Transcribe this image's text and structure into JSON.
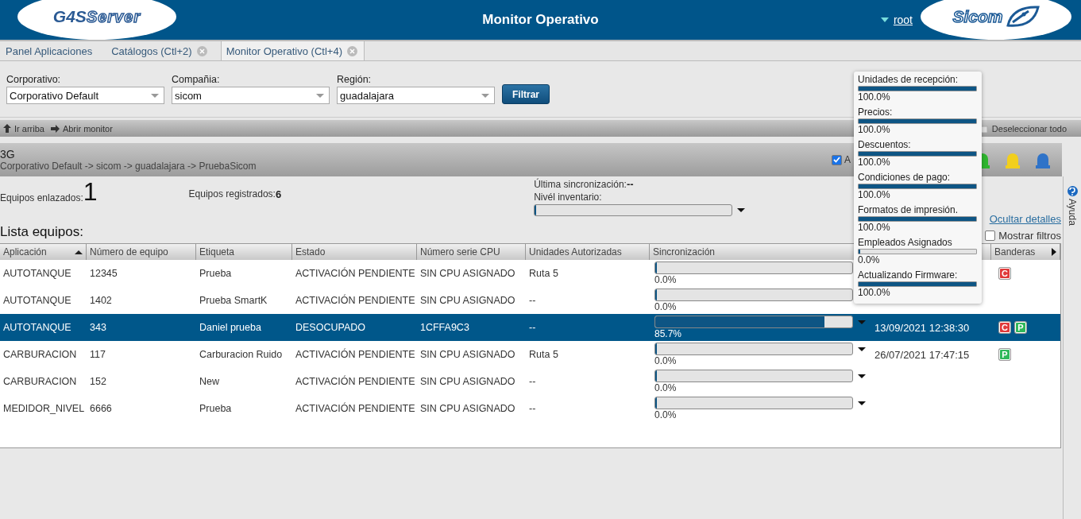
{
  "header": {
    "logo_left": {
      "prefix": "G4S",
      "suffix": "Server"
    },
    "title": "Monitor Operativo",
    "user": "root",
    "logo_right": "Sicom"
  },
  "tabs": [
    {
      "label": "Panel Aplicaciones",
      "selected": false,
      "closable": false
    },
    {
      "label": "Catálogos (Ctl+2)",
      "selected": false,
      "closable": true
    },
    {
      "label": "Monitor Operativo (Ctl+4)",
      "selected": true,
      "closable": true
    }
  ],
  "filters": [
    {
      "label": "Corporativo:",
      "value": "Corporativo Default"
    },
    {
      "label": "Compañia:",
      "value": "sicom"
    },
    {
      "label": "Región:",
      "value": "guadalajara"
    }
  ],
  "filter_button": "Filtrar",
  "toolbar": {
    "up": "Ir arriba",
    "open": "Abrir monitor",
    "deselect": "Deseleccionar todo"
  },
  "group": {
    "title": "3G",
    "path": "Corporativo Default -> sicom -> guadalajara -> PruebaSicom",
    "checkbox": {
      "label": "A",
      "checked": true
    },
    "lights": [
      {
        "color": "#2fb52f"
      },
      {
        "color": "#f2cf1d"
      },
      {
        "color": "#2f73c8"
      }
    ]
  },
  "summary": {
    "linked_label": "Equipos enlazados:",
    "linked_value": "1",
    "registered_label": "Equipos registrados:",
    "registered_value": "6",
    "last_sync_label": "Última sincronización:",
    "last_sync_value": "--",
    "inventory_label": "Nivél inventario:",
    "inventory": {
      "level": 0
    },
    "hide_details": "Ocultar detalles",
    "show_filters": {
      "label": "Mostrar filtros",
      "checked": false
    }
  },
  "list_title": "Lista equipos:",
  "table": {
    "columns": [
      "Aplicación",
      "Número de equipo",
      "Etiqueta",
      "Estado",
      "Número serie CPU",
      "Unidades Autorizadas",
      "Sincronización",
      "Banderas"
    ],
    "rows": [
      {
        "selected": false,
        "cells": [
          "AUTOTANQUE",
          "12345",
          "Prueba",
          "ACTIVACIÓN PENDIENTE",
          "SIN CPU ASIGNADO",
          "Ruta 5"
        ],
        "sync": {
          "level": 0,
          "reading": "0.0%"
        },
        "flags": [
          {
            "text": "C",
            "color": "#e03a3a"
          }
        ]
      },
      {
        "selected": false,
        "cells": [
          "AUTOTANQUE",
          "1402",
          "Prueba SmartK",
          "ACTIVACIÓN PENDIENTE",
          "SIN CPU ASIGNADO",
          "--"
        ],
        "sync": {
          "level": 0,
          "reading": "0.0%"
        },
        "flags": []
      },
      {
        "selected": true,
        "cells": [
          "AUTOTANQUE",
          "343",
          "Daniel prueba",
          "DESOCUPADO",
          "1CFFA9C3",
          "--"
        ],
        "sync": {
          "level": 0.857,
          "reading": "85.7%"
        },
        "date": "13/09/2021 12:38:30",
        "flags": [
          {
            "text": "C",
            "color": "#e03a3a"
          },
          {
            "text": "P",
            "color": "#2fb85a"
          }
        ]
      },
      {
        "selected": false,
        "cells": [
          "CARBURACION",
          "117",
          "Carburacion Ruido",
          "ACTIVACIÓN PENDIENTE",
          "SIN CPU ASIGNADO",
          "Ruta 5"
        ],
        "sync": {
          "level": 0,
          "reading": "0.0%"
        },
        "date": "26/07/2021 17:47:15",
        "flags": [
          {
            "text": "P",
            "color": "#2fb85a"
          }
        ]
      },
      {
        "selected": false,
        "cells": [
          "CARBURACION",
          "152",
          "New",
          "ACTIVACIÓN PENDIENTE",
          "SIN CPU ASIGNADO",
          "--"
        ],
        "sync": {
          "level": 0,
          "reading": "0.0%"
        },
        "flags": []
      },
      {
        "selected": false,
        "cells": [
          "MEDIDOR_NIVEL",
          "6666",
          "Prueba",
          "ACTIVACIÓN PENDIENTE",
          "SIN CPU ASIGNADO",
          "--"
        ],
        "sync": {
          "level": 0,
          "reading": "0.0%"
        },
        "flags": []
      }
    ]
  },
  "popup": [
    {
      "label": "Unidades de recepción:",
      "level": 1,
      "reading": "100.0%"
    },
    {
      "label": "Precios:",
      "level": 1,
      "reading": "100.0%"
    },
    {
      "label": "Descuentos:",
      "level": 1,
      "reading": "100.0%"
    },
    {
      "label": "Condiciones de pago:",
      "level": 1,
      "reading": "100.0%"
    },
    {
      "label": "Formatos de impresión.",
      "level": 1,
      "reading": "100.0%"
    },
    {
      "label": "Empleados Asignados",
      "level": 0,
      "reading": "0.0%"
    },
    {
      "label": "Actualizando Firmware:",
      "level": 1,
      "reading": "100.0%"
    }
  ],
  "help": "Ayuda"
}
